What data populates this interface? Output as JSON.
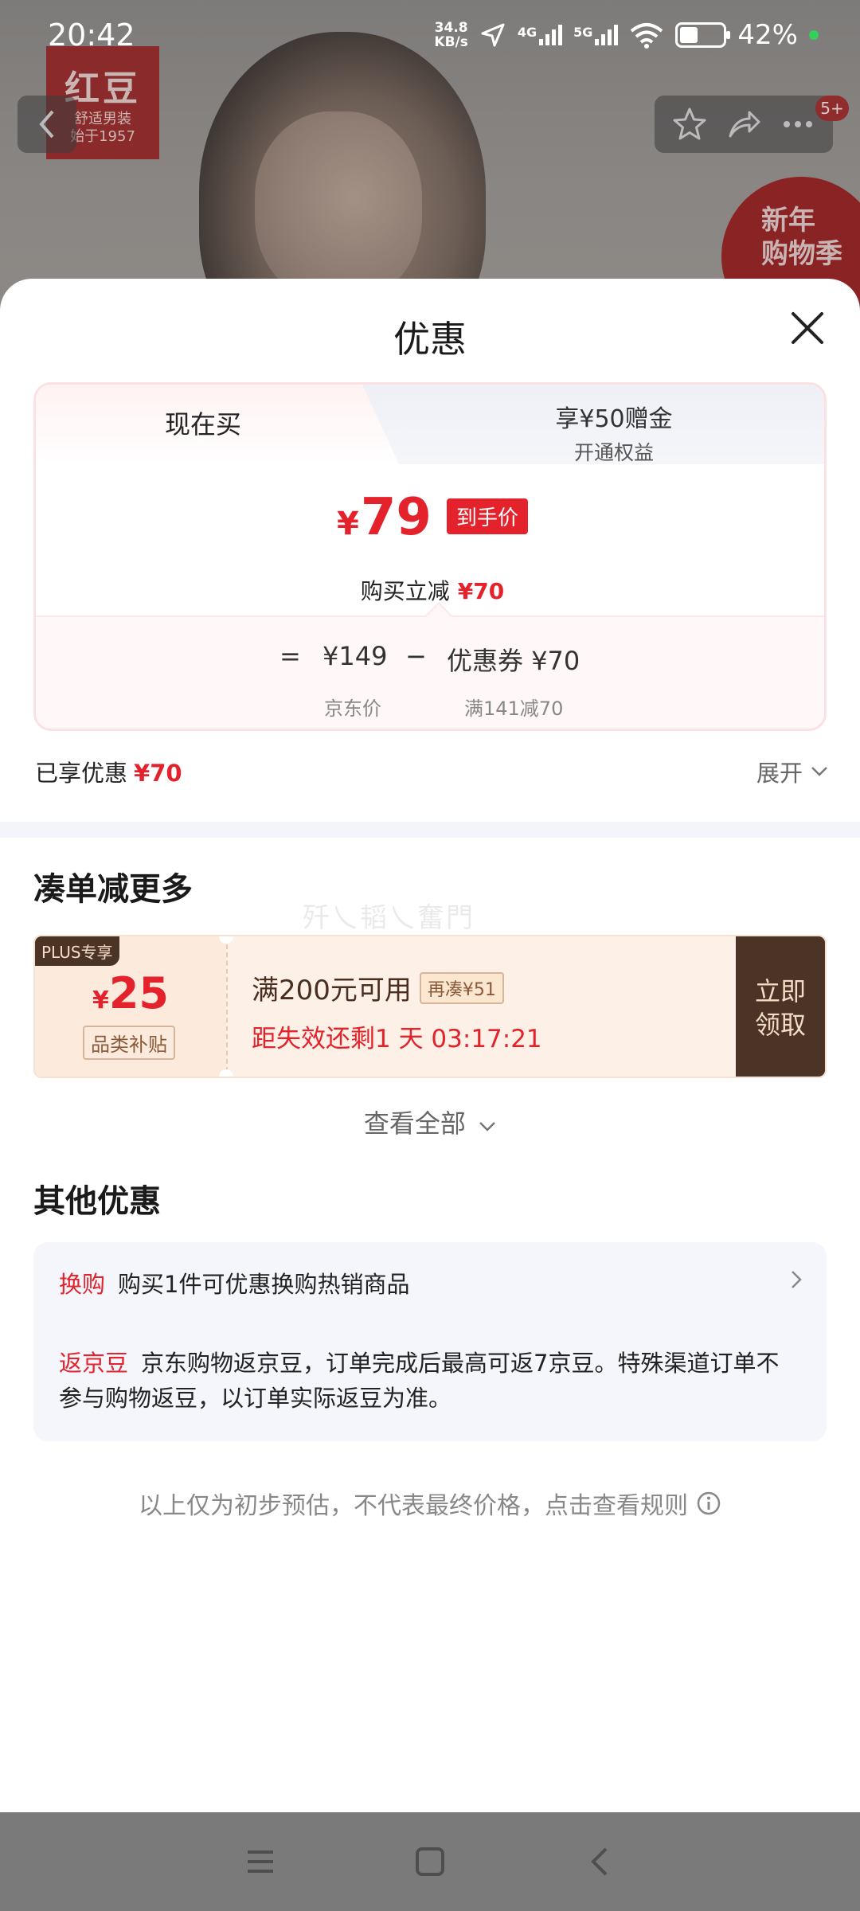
{
  "status_bar": {
    "time": "20:42",
    "net_speed_value": "34.8",
    "net_speed_unit": "KB/s",
    "sim1": "4G",
    "sim2": "5G",
    "battery_percent": 42,
    "battery_text": "42%"
  },
  "background": {
    "brand_logo": "红豆",
    "brand_slogan_1": "舒适男装",
    "brand_slogan_2": "始于1957",
    "cart_badge": "5+",
    "promo_line1": "新年",
    "promo_line2": "购物季"
  },
  "sheet": {
    "title": "优惠"
  },
  "price_card": {
    "tabs": [
      {
        "label": "现在买",
        "active": true
      },
      {
        "label": "享¥50赠金",
        "sublabel": "开通权益",
        "active": false
      }
    ],
    "currency": "¥",
    "final_price": "79",
    "final_tag": "到手价",
    "instant_discount_label": "购买立减",
    "instant_discount_value": "¥70",
    "equals": "=",
    "jd_price": "¥149",
    "jd_price_label": "京东价",
    "minus": "−",
    "coupon_label": "优惠券",
    "coupon_value": "¥70",
    "coupon_rule": "满141减70"
  },
  "summary": {
    "enjoyed_label": "已享优惠",
    "enjoyed_value": "¥70",
    "expand_label": "展开"
  },
  "bundle_section": {
    "title": "凑单减更多",
    "watermark": "歼乀韬乀奮門",
    "coupon": {
      "badge": "PLUS专享",
      "currency": "¥",
      "amount": "25",
      "category": "品类补贴",
      "condition": "满200元可用",
      "extra": "再凑¥51",
      "timer": "距失效还剩1 天 03:17:21",
      "button_line1": "立即",
      "button_line2": "领取"
    },
    "view_all": "查看全部"
  },
  "other_section": {
    "title": "其他优惠",
    "items": [
      {
        "tag": "换购",
        "text": "购买1件可优惠换购热销商品"
      },
      {
        "tag": "返京豆",
        "text": "京东购物返京豆，订单完成后最高可返7京豆。特殊渠道订单不参与购物返豆，以订单实际返豆为准。"
      }
    ]
  },
  "disclaimer": "以上仅为初步预估，不代表最终价格，点击查看规则",
  "colors": {
    "accent_red": "#e4222c",
    "coupon_brown": "#4b3426"
  }
}
